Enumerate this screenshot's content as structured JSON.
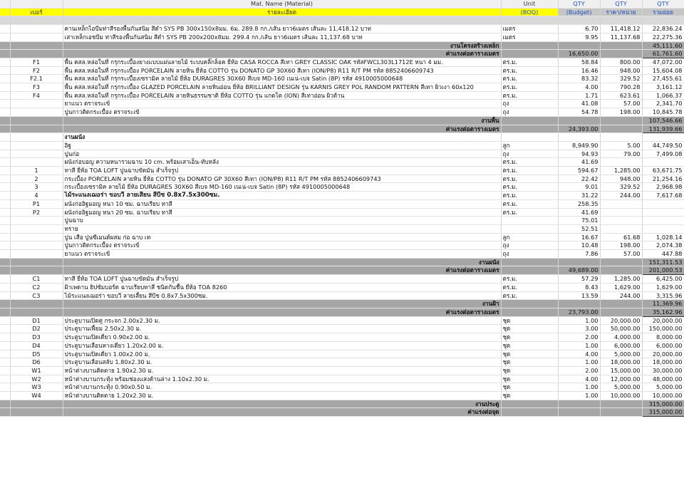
{
  "header": {
    "material": "Mat. Name (Material)",
    "unit": "Unit",
    "qty": "QTY",
    "no_label": "เบอร์",
    "detail_label": "รายละเอียด",
    "boq": "(BOQ)",
    "budget": "(Budget)",
    "unit_price": "ราคา/หน่วย",
    "total": "รวมย่อย"
  },
  "rows": [
    {
      "t": "blank"
    },
    {
      "t": "item",
      "no": "",
      "desc": "คานเหล็กไอบีมท่าสีรองพื้นกันสนิม สีดำ SYS PB 300x150x8มม. 6ม. 289.8 กก./เส้น ยาว6เมตร เส้นละ 11,418.12 บาท",
      "unit": "เมตร",
      "boq": "6.70",
      "price": "11,418.12",
      "total": "22,836.24"
    },
    {
      "t": "item",
      "no": "",
      "desc": "เสาเหล็กเอชบีม ท่าสีรองพื้นกันสนิม สีดำ SYS PB 200x200x8มม. 299.4 กก./เส้น ยาว6เมตร เส้นละ 11,137.68 บาท",
      "unit": "เมตร",
      "boq": "9.95",
      "price": "11,137.68",
      "total": "22,275.36"
    },
    {
      "t": "sub",
      "label": "งานโครงสร้างเหล็ก",
      "budget": "",
      "total": "45,111.60"
    },
    {
      "t": "sub",
      "label": "ค่าแรงต่อตารางเมตร",
      "budget": "16,650.00",
      "total": "61,761.60",
      "box": true
    },
    {
      "t": "item",
      "no": "F1",
      "desc": "พื้น คสล.หล่อในที่ กรุกระเบื้องยางแบบแผ่นลายไม้ ระบบคลิ๊กล็อค ยี่ห้อ CASA ROCCA สีเทา GREY CLASSIC OAK รหัสFWCL303L1712E หนา 4 มม.",
      "unit": "ตร.ม.",
      "boq": "58.84",
      "price": "800.00",
      "total": "47,072.00"
    },
    {
      "t": "item",
      "no": "F2",
      "desc": "พื้น คสล.หล่อในที่ กรุกระเบื้อง PORCELAIN ลายหิน ยี่ห้อ COTTO รุ่น DONATO GP 30X60 สีเทา (ION/P8) R11 R/T PM รหัส 8852406609743",
      "unit": "ตร.ม.",
      "boq": "16.46",
      "price": "948.00",
      "total": "15,604.08"
    },
    {
      "t": "item",
      "no": "F2.1",
      "desc": "พื้น คสล.หล่อในที่ กรุกระเบื้องเซรามิค ลายไม้ ยี่ห้อ DURAGRES 30X60 สีเบจ MD-160 เนเน่-เบจ Satin (8P) รหัส 4910005000648",
      "unit": "ตร.ม.",
      "boq": "83.32",
      "price": "329.52",
      "total": "27,455.61"
    },
    {
      "t": "item",
      "no": "F3",
      "desc": "พื้น คสล.หล่อในที่ กรุกระเบื้อง GLAZED PORCELAIN ลายหินอ่อน ยี่ห้อ BRILLIANT DESIGN รุ่น KARNIS GREY POL RANDOM PATTERN สีเทา ผิวเงา 60x120",
      "unit": "ตร.ม.",
      "boq": "4.00",
      "price": "790.28",
      "total": "3,161.12"
    },
    {
      "t": "item",
      "no": "F4",
      "desc": "พื้น คสล.หล่อในที่ กรุกระเบื้อง PORCELAIN ลายหินธรรมชาติ ยี่ห้อ COTTO รุ่น แกดโด (ION) สีเทาอ่อน ผิวด้าน",
      "unit": "ตร.ม.",
      "boq": "1.71",
      "price": "623.61",
      "total": "1,066.37"
    },
    {
      "t": "item",
      "no": "",
      "desc": "ยาแนว ตราจระเข้",
      "unit": "ถุง",
      "boq": "41.08",
      "price": "57.00",
      "total": "2,341.70"
    },
    {
      "t": "item",
      "no": "",
      "desc": "ปูนกาวติดกระเบื้อง ตราจระเข้",
      "unit": "ถุง",
      "boq": "54.78",
      "price": "198.00",
      "total": "10,845.78"
    },
    {
      "t": "sub",
      "label": "งานพื้น",
      "budget": "",
      "total": "107,546.66"
    },
    {
      "t": "sub",
      "label": "ค่าแรงต่อตารางเมตร",
      "budget": "24,393.00",
      "total": "131,939.66",
      "box": true
    },
    {
      "t": "item",
      "no": "",
      "desc": "งานผนัง",
      "unit": "",
      "boq": "",
      "price": "",
      "total": "",
      "bold": true
    },
    {
      "t": "item",
      "no": "",
      "desc": "อิฐ",
      "unit": "ลูก",
      "boq": "8,949.90",
      "price": "5.00",
      "total": "44,749.50"
    },
    {
      "t": "item",
      "no": "",
      "desc": "ปูนก่อ",
      "unit": "ถุง",
      "boq": "94.93",
      "price": "79.00",
      "total": "7,499.08"
    },
    {
      "t": "item",
      "no": "",
      "desc": "ผนังก่อบอญ ความหนารวมฉาบ 10 cm. พร้อมเสาเอ็น-ทับหลัง",
      "unit": "ตร.ม.",
      "boq": "41.69",
      "price": "",
      "total": ""
    },
    {
      "t": "item",
      "no": "1",
      "desc": "ทาสี ยี่ห้อ TOA LOFT ปูนฉาบขัดมัน สำเร็จรูป",
      "unit": "ตร.ม.",
      "boq": "594.67",
      "price": "1,285.00",
      "total": "63,671.75"
    },
    {
      "t": "item",
      "no": "2",
      "desc": "กระเบื้อง PORCELAIN ลายหิน ยี่ห้อ COTTO รุ่น DONATO GP 30X60 สีเทา (ION/P8) R11 R/T PM รหัส 8852406609743",
      "unit": "ตร.ม.",
      "boq": "22.42",
      "price": "948.00",
      "total": "21,254.16"
    },
    {
      "t": "item",
      "no": "3",
      "desc": "กระเบื้องเซรามิค ลายไม้ ยี่ห้อ DURAGRES 30X60 สีเบจ MD-160 เนเน่-เบจ Satin (8P) รหัส 4910005000648",
      "unit": "ตร.ม.",
      "boq": "9.01",
      "price": "329.52",
      "total": "2,968.98"
    },
    {
      "t": "item",
      "no": "4",
      "desc": "ไม้ระแนงเฌอร่า ขอบวี ลายเสี้ยน สีบีช 0.8x7.5x300ซม.",
      "unit": "ตร.ม.",
      "boq": "31.22",
      "price": "244.00",
      "total": "7,617.68",
      "bold2": true
    },
    {
      "t": "item",
      "no": "P1",
      "desc": "ผนังก่ออิฐมอญ หนา 10 ซม. ฉาบเรียบ ทาสี",
      "unit": "ตร.ม.",
      "boq": "258.35",
      "price": "",
      "total": ""
    },
    {
      "t": "item",
      "no": "P2",
      "desc": "ผนังก่ออิฐมอญ หนา 20 ซม. ฉาบเรียบ ทาสี",
      "unit": "ตร.ม.",
      "boq": "41.69",
      "price": "",
      "total": ""
    },
    {
      "t": "item",
      "no": "",
      "desc": "ปูนฉาบ",
      "unit": "",
      "boq": "75.01",
      "price": "",
      "total": ""
    },
    {
      "t": "item",
      "no": "",
      "desc": "ทราย",
      "unit": "",
      "boq": "52.51",
      "price": "",
      "total": ""
    },
    {
      "t": "item",
      "no": "",
      "desc": "ปูน เสือ ปูนซีเมนต์ผสม ก่อ ฉาบ เท",
      "unit": "ลูก",
      "boq": "16.67",
      "price": "61.68",
      "total": "1,028.14"
    },
    {
      "t": "item",
      "no": "",
      "desc": "ปูนกาวติดกระเบื้อง ตราจระเข้",
      "unit": "ถุง",
      "boq": "10.48",
      "price": "198.00",
      "total": "2,074.38"
    },
    {
      "t": "item",
      "no": "",
      "desc": "ยาแนว ตราจระเข้",
      "unit": "ถุง",
      "boq": "7.86",
      "price": "57.00",
      "total": "447.88"
    },
    {
      "t": "sub",
      "label": "งานผนัง",
      "budget": "",
      "total": "151,311.53"
    },
    {
      "t": "sub",
      "label": "ค่าแรงต่อตารางเมตร",
      "budget": "49,689.00",
      "total": "201,000.53",
      "box": true
    },
    {
      "t": "item",
      "no": "C1",
      "desc": "ทาสี ยี่ห้อ TOA LOFT ปูนฉาบขัดมัน สำเร็จรูป",
      "unit": "ตร.ม.",
      "boq": "57.29",
      "price": "1,285.00",
      "total": "6,425.00"
    },
    {
      "t": "item",
      "no": "C2",
      "desc": "ฝ้าเพดาน ยิปซัมบอร์ด ฉาบเรียบทาสี ชนิดกันชื้น ยี่ห้อ TOA 8260",
      "unit": "ตร.ม.",
      "boq": "8.43",
      "price": "1,629.00",
      "total": "1,629.00"
    },
    {
      "t": "item",
      "no": "C3",
      "desc": "ไม้ระแนงเฌอร่า ขอบวี ลายเสี้ยน สีบีช 0.8x7.5x300ซม.",
      "unit": "ตร.ม.",
      "boq": "13.59",
      "price": "244.00",
      "total": "3,315.96"
    },
    {
      "t": "sub",
      "label": "งานฝ้า",
      "budget": "",
      "total": "11,369.96"
    },
    {
      "t": "sub",
      "label": "ค่าแรงต่อตารางเมตร",
      "budget": "23,793.00",
      "total": "35,162.96",
      "box": true
    },
    {
      "t": "item",
      "no": "D1",
      "desc": "ประตูบานเปิดคู่ กระจก 2.00x2.30 ม.",
      "unit": "ชุด",
      "boq": "1.00",
      "price": "20,000.00",
      "total": "20,000.00"
    },
    {
      "t": "item",
      "no": "D2",
      "desc": "ประตูบานเฟี้ยม 2.50x2.30 ม.",
      "unit": "ชุด",
      "boq": "3.00",
      "price": "50,000.00",
      "total": "150,000.00"
    },
    {
      "t": "item",
      "no": "D3",
      "desc": "ประตูบานเปิดเดี่ยว 0.90x2.00 ม.",
      "unit": "ชุด",
      "boq": "2.00",
      "price": "4,000.00",
      "total": "8,000.00"
    },
    {
      "t": "item",
      "no": "D4",
      "desc": "ประตูบานเลื่อนหางเดี่ยว 1.20x2.00 ม.",
      "unit": "ชุด",
      "boq": "1.00",
      "price": "6,000.00",
      "total": "6,000.00"
    },
    {
      "t": "item",
      "no": "D5",
      "desc": "ประตูบานเปิดเดี่ยว 1.00x2.00 ม.",
      "unit": "ชุด",
      "boq": "4.00",
      "price": "5,000.00",
      "total": "20,000.00"
    },
    {
      "t": "item",
      "no": "D6",
      "desc": "ประตูบานเลื่อนสลับ 1.80x2.30 ม.",
      "unit": "ชุด",
      "boq": "1.00",
      "price": "18,000.00",
      "total": "18,000.00"
    },
    {
      "t": "item",
      "no": "W1",
      "desc": "หน้าต่างบานติดตาย 1.90x2.30 ม.",
      "unit": "ชุด",
      "boq": "2.00",
      "price": "15,000.00",
      "total": "30,000.00"
    },
    {
      "t": "item",
      "no": "W2",
      "desc": "หน้าต่างบานกระทุ้ง พร้อมช่องแสงด้านล่าง 1.10x2.30 ม.",
      "unit": "ชุด",
      "boq": "4.00",
      "price": "12,000.00",
      "total": "48,000.00"
    },
    {
      "t": "item",
      "no": "W3",
      "desc": "หน้าต่างบานกระทุ้ง 0.90x0.50 ม.",
      "unit": "ชุด",
      "boq": "1.00",
      "price": "5,000.00",
      "total": "5,000.00"
    },
    {
      "t": "item",
      "no": "W4",
      "desc": "หน้าต่างบานติดตาย 1.20x2.30 ม.",
      "unit": "ชุด",
      "boq": "1.00",
      "price": "10,000.00",
      "total": "10,000.00"
    },
    {
      "t": "sub",
      "label": "งานประตู",
      "budget": "",
      "total": "315,000.00"
    },
    {
      "t": "sub",
      "label": "ค่าแรงต่อจุด",
      "budget": "",
      "total": "315,000.00",
      "box": true
    }
  ]
}
